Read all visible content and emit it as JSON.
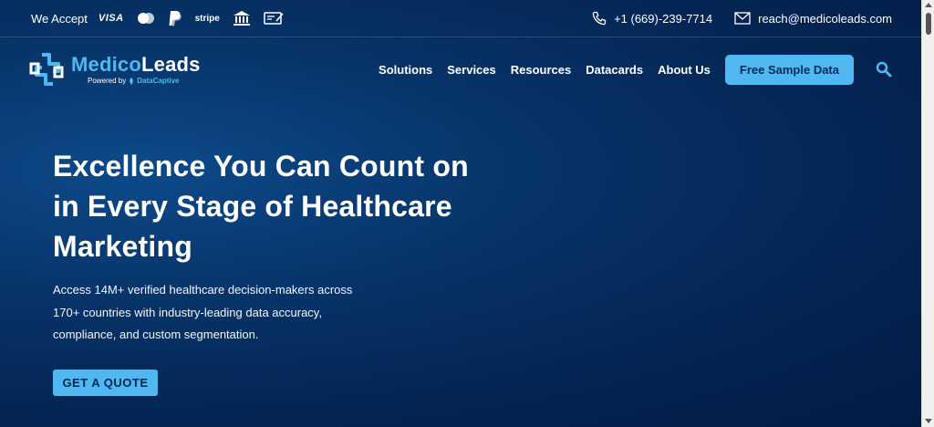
{
  "topbar": {
    "accept_label": "We Accept",
    "payments": [
      {
        "icon": "visa-icon",
        "text": "VISA"
      },
      {
        "icon": "mastercard-icon",
        "text": ""
      },
      {
        "icon": "paypal-icon",
        "text": ""
      },
      {
        "icon": "stripe-icon",
        "text": "stripe"
      },
      {
        "icon": "bank-icon",
        "text": ""
      },
      {
        "icon": "check-icon",
        "text": ""
      }
    ],
    "phone": "+1 (669)-239-7714",
    "email": "reach@medicoleads.com"
  },
  "nav": {
    "brand_part1": "Medico",
    "brand_part2": "Leads",
    "powered_by": "Powered by",
    "powered_brand": "DataCaptive",
    "menu": [
      "Solutions",
      "Services",
      "Resources",
      "Datacards",
      "About Us"
    ],
    "cta_label": "Free Sample Data"
  },
  "hero": {
    "title": "Excellence You Can Count on in Every Stage of Healthcare Marketing",
    "description": "Access 14M+ verified healthcare decision-makers across 170+ countries with industry-leading data accuracy, compliance, and custom segmentation.",
    "cta_label": "GET A QUOTE"
  },
  "colors": {
    "accent": "#4fb8f0",
    "background": "#062a5c"
  }
}
